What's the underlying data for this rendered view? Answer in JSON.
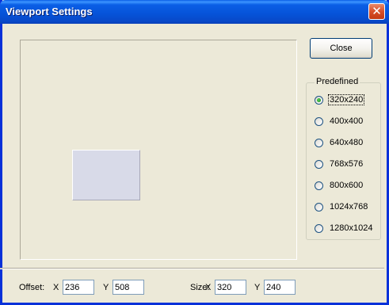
{
  "window": {
    "title": "Viewport Settings",
    "close_glyph": "✕"
  },
  "close_button": {
    "label": "Close"
  },
  "predefined": {
    "legend": "Predefined",
    "options": [
      {
        "label": "320x240",
        "checked": true
      },
      {
        "label": "400x400",
        "checked": false
      },
      {
        "label": "640x480",
        "checked": false
      },
      {
        "label": "768x576",
        "checked": false
      },
      {
        "label": "800x600",
        "checked": false
      },
      {
        "label": "1024x768",
        "checked": false
      },
      {
        "label": "1280x1024",
        "checked": false
      }
    ]
  },
  "offset": {
    "label": "Offset:",
    "x_label": "X",
    "x_value": "236",
    "y_label": "Y",
    "y_value": "508"
  },
  "size": {
    "label": "Size:",
    "x_label": "X",
    "x_value": "320",
    "y_label": "Y",
    "y_value": "240"
  },
  "colors": {
    "title_bar": "#0a5fe6",
    "window_bg": "#ece9d8",
    "viewport_rect": "#d8dae8",
    "close_x_bg": "#d8502a",
    "radio_dot": "#21a121"
  }
}
